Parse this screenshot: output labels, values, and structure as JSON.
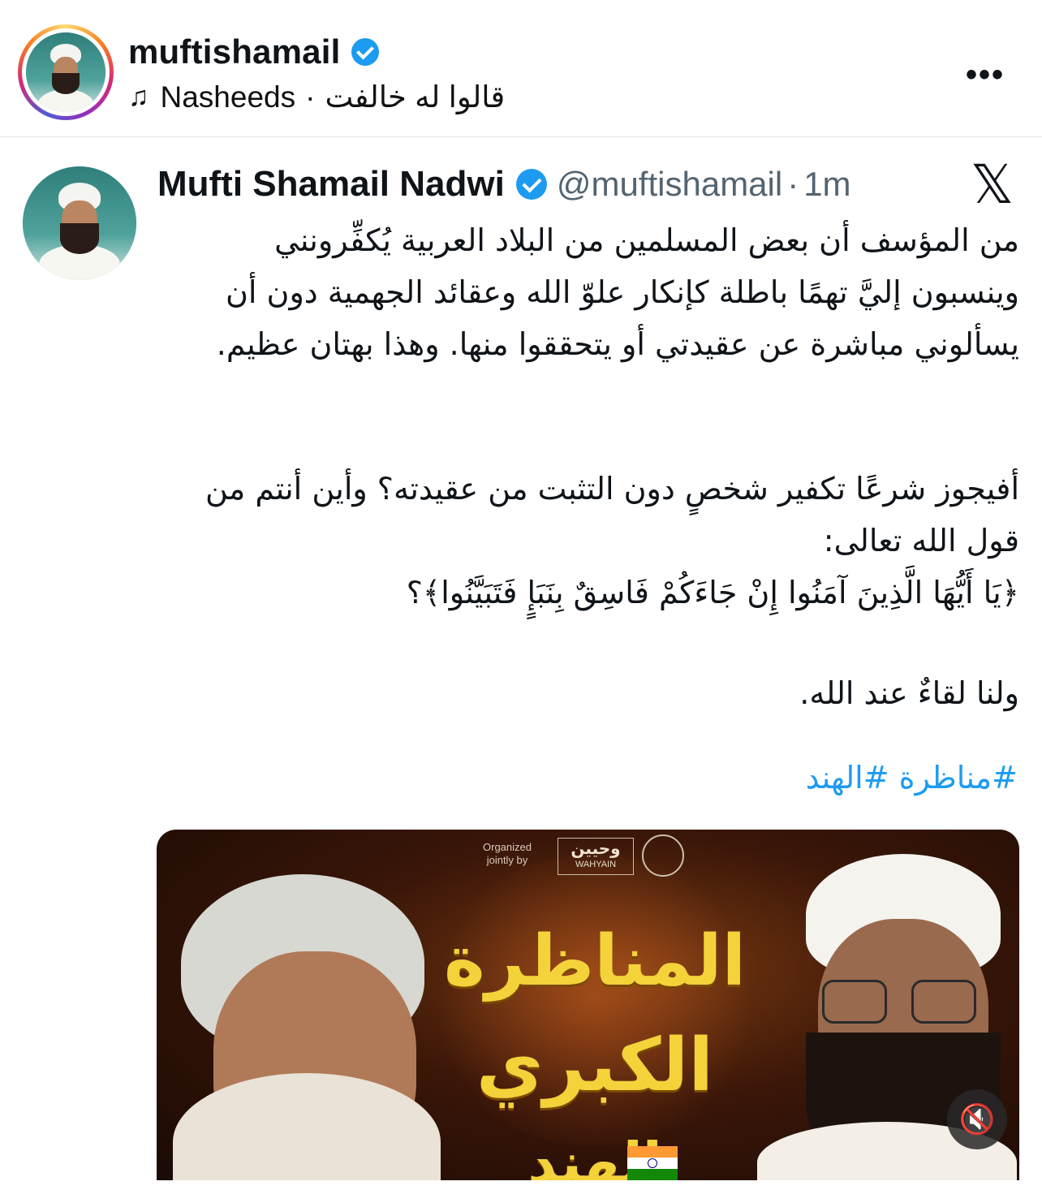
{
  "ig_header": {
    "username": "muftishamail",
    "audio_artist": "Nasheeds",
    "audio_separator": "·",
    "audio_track": "قالوا له خالفت",
    "more_label": "•••"
  },
  "tweet": {
    "display_name": "Mufti Shamail Nadwi",
    "handle": "@muftishamail",
    "dot": "·",
    "time": "1m",
    "x_logo": "𝕏",
    "paragraphs": [
      "من المؤسف أن بعض المسلمين من البلاد العربية يُكفِّرونني وينسبون إليَّ تهمًا باطلة كإنكار علوّ الله وعقائد الجهمية دون أن يسألوني مباشرة عن عقيدتي أو يتحققوا منها. وهذا بهتان عظيم.",
      "أفيجوز شرعًا تكفير شخصٍ دون التثبت من عقيدته؟ وأين أنتم من قول الله تعالى:\n﴿يَا أَيُّهَا الَّذِينَ آمَنُوا إِنْ جَاءَكُمْ فَاسِقٌ بِنَبَإٍ فَتَبَيَّنُوا﴾؟",
      "ولنا لقاءٌ عند الله."
    ],
    "hashtags": [
      "#مناظرة",
      "#الهند"
    ]
  },
  "media": {
    "organized_label": "Organized\njointly by",
    "logo_text": "WAHYAIN",
    "title_line1": "المناظرة",
    "title_line2": "الكبري",
    "title_line3": "الهند",
    "mute_icon": "🔇"
  },
  "colors": {
    "verified": "#1d9bf0",
    "link": "#1d9bf0",
    "muted_text": "#536471",
    "title_gold": "#f4d23a"
  }
}
